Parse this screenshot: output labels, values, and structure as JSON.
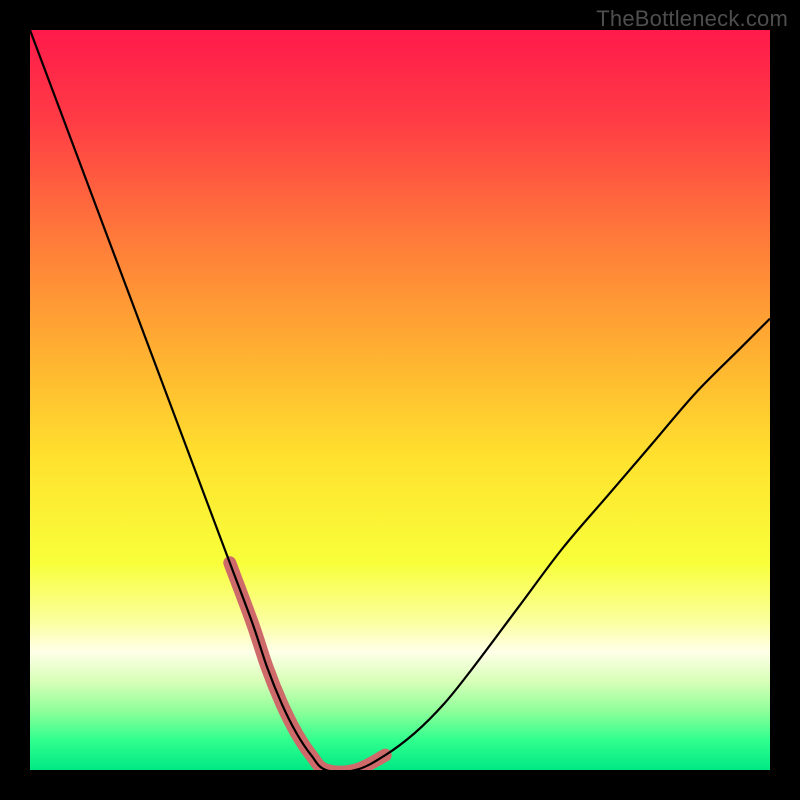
{
  "watermark": {
    "text": "TheBottleneck.com"
  },
  "chart_data": {
    "type": "line",
    "title": "",
    "xlabel": "",
    "ylabel": "",
    "xlim": [
      0,
      100
    ],
    "ylim": [
      0,
      100
    ],
    "grid": false,
    "legend": false,
    "background_gradient_stops": [
      {
        "pct": 0,
        "color": "#ff1a4b"
      },
      {
        "pct": 12,
        "color": "#ff3b45"
      },
      {
        "pct": 28,
        "color": "#ff7a3a"
      },
      {
        "pct": 45,
        "color": "#ffb531"
      },
      {
        "pct": 58,
        "color": "#ffe22e"
      },
      {
        "pct": 72,
        "color": "#f8ff3a"
      },
      {
        "pct": 80,
        "color": "#fbffa0"
      },
      {
        "pct": 84,
        "color": "#ffffe8"
      },
      {
        "pct": 88,
        "color": "#d8ffb8"
      },
      {
        "pct": 92,
        "color": "#8fff9a"
      },
      {
        "pct": 96,
        "color": "#30ff8e"
      },
      {
        "pct": 100,
        "color": "#00e884"
      }
    ],
    "series": [
      {
        "name": "bottleneck-curve",
        "color": "#000000",
        "width": 2.2,
        "x": [
          0,
          3,
          6,
          9,
          12,
          15,
          18,
          21,
          24,
          27,
          30,
          32,
          34,
          36,
          38,
          40,
          44,
          48,
          52,
          56,
          60,
          66,
          72,
          78,
          84,
          90,
          96,
          100
        ],
        "y": [
          100,
          92,
          84,
          76,
          68,
          60,
          52,
          44,
          36,
          28,
          20,
          14,
          9,
          5,
          2,
          0,
          0,
          2,
          5,
          9,
          14,
          22,
          30,
          37,
          44,
          51,
          57,
          61
        ]
      },
      {
        "name": "highlight-band",
        "color": "#cf6a6a",
        "width": 13,
        "linecap": "round",
        "x": [
          27,
          30,
          32,
          34,
          36,
          38,
          40,
          44,
          48
        ],
        "y": [
          28,
          20,
          14,
          9,
          5,
          2,
          0,
          0,
          2
        ]
      }
    ]
  }
}
